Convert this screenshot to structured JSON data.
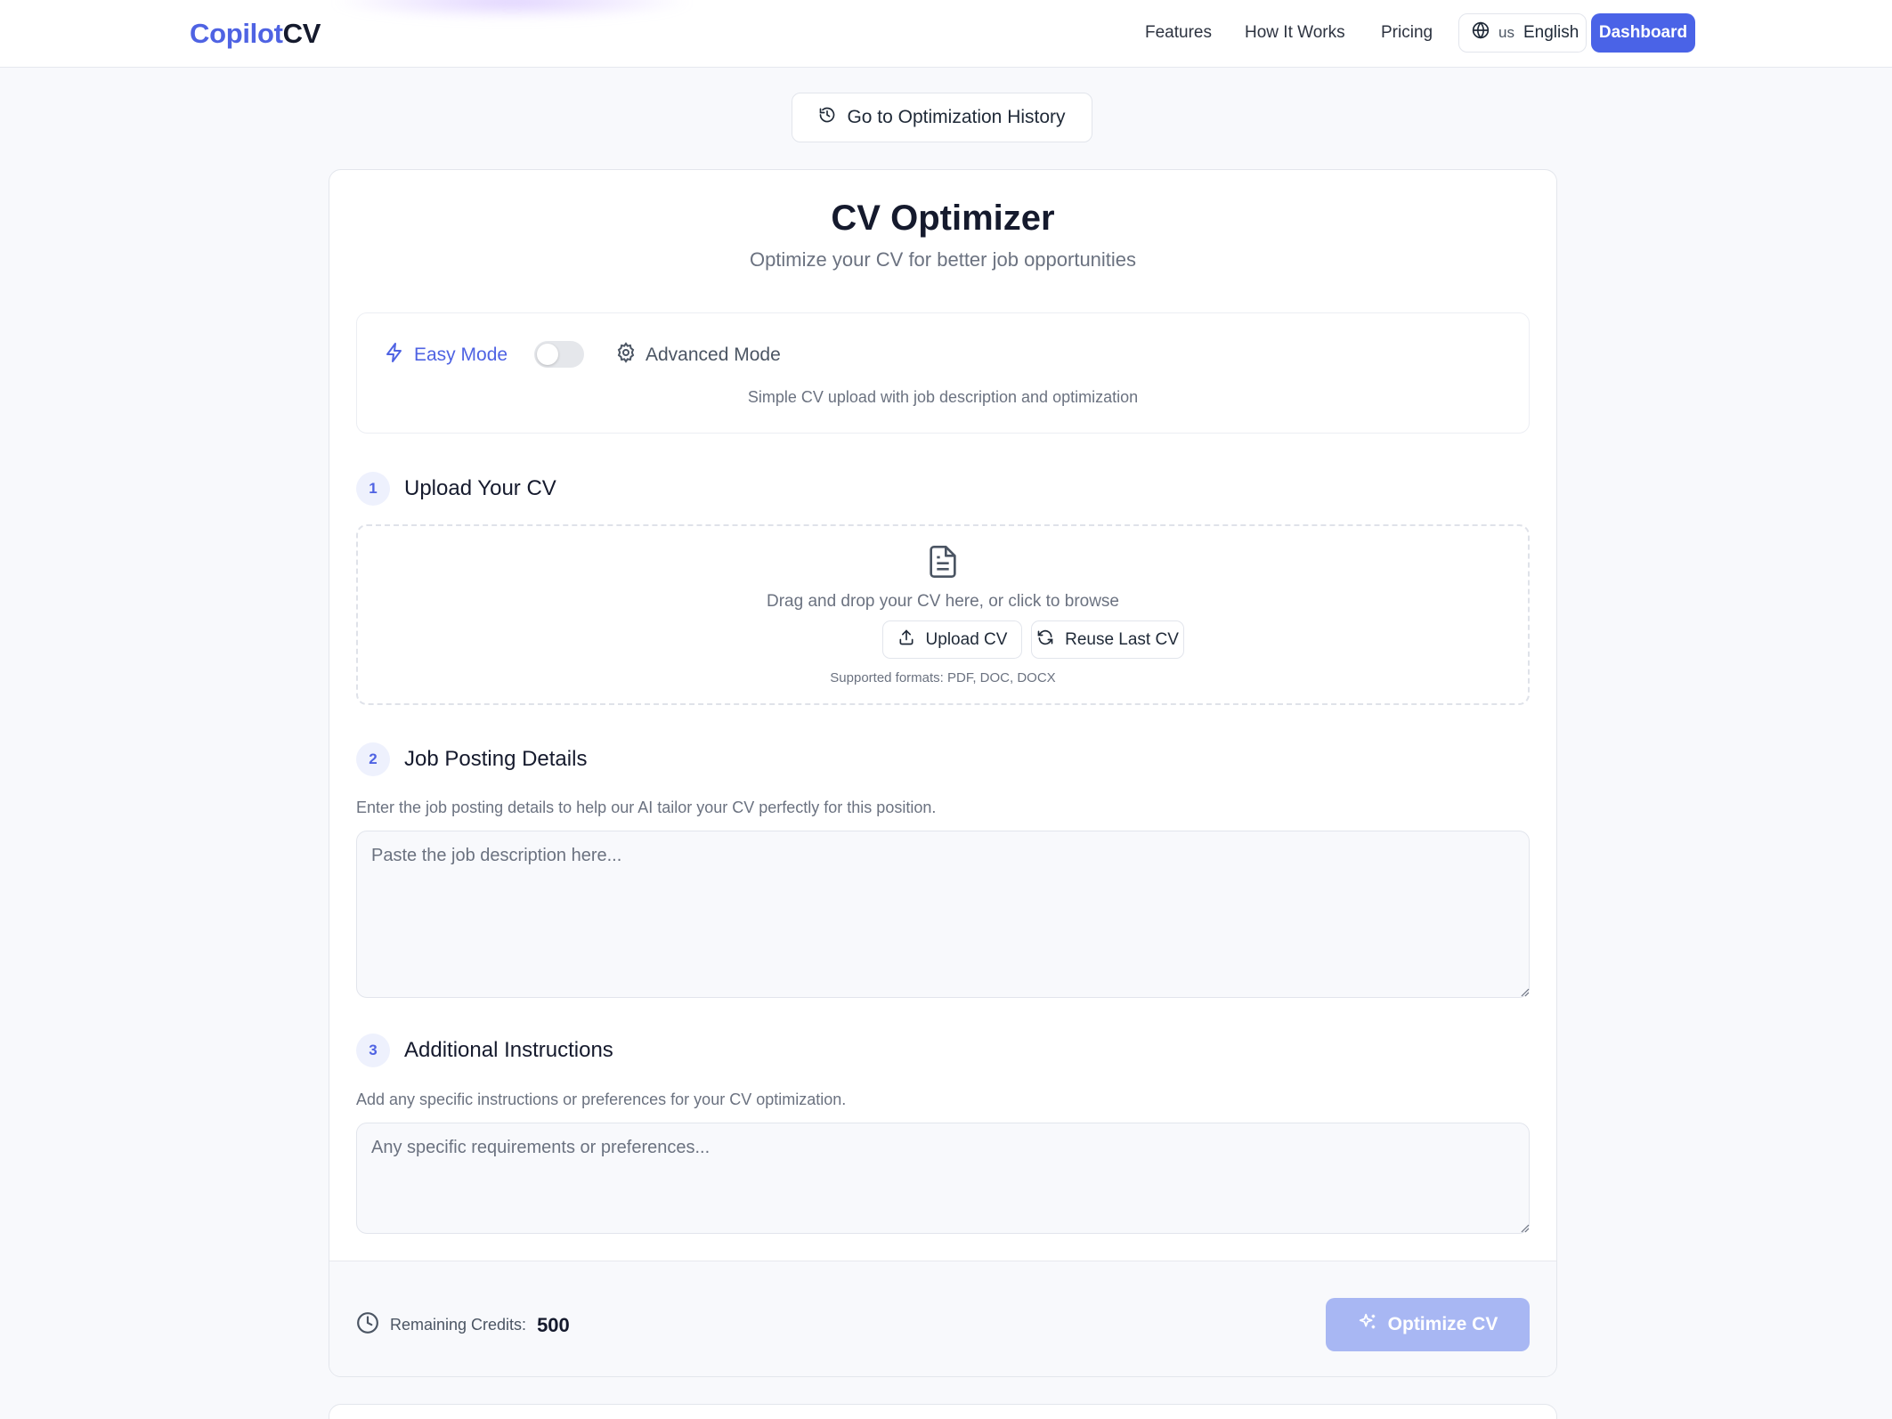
{
  "header": {
    "logo_part1": "Copilot",
    "logo_part2": "CV",
    "nav": [
      "Features",
      "How It Works",
      "Pricing"
    ],
    "language_code": "us",
    "language_name": "English",
    "dashboard_label": "Dashboard"
  },
  "history_button": "Go to Optimization History",
  "optimizer": {
    "title": "CV Optimizer",
    "subtitle": "Optimize your CV for better job opportunities",
    "mode": {
      "easy_label": "Easy Mode",
      "advanced_label": "Advanced Mode",
      "description": "Simple CV upload with job description and optimization",
      "advanced_enabled": false
    },
    "steps": [
      {
        "number": "1",
        "label": "Upload Your CV"
      },
      {
        "number": "2",
        "label": "Job Posting Details"
      },
      {
        "number": "3",
        "label": "Additional Instructions"
      }
    ],
    "upload": {
      "prompt": "Drag and drop your CV here, or click to browse",
      "upload_label": "Upload CV",
      "reuse_label": "Reuse Last CV",
      "formats": "Supported formats: PDF, DOC, DOCX"
    },
    "job": {
      "helper": "Enter the job posting details to help our AI tailor your CV perfectly for this position.",
      "placeholder": "Paste the job description here..."
    },
    "instructions": {
      "helper": "Add any specific instructions or preferences for your CV optimization.",
      "placeholder": "Any specific requirements or preferences..."
    },
    "footer": {
      "credits_label": "Remaining Credits:",
      "credits_value": "500",
      "optimize_label": "Optimize CV"
    }
  },
  "colors": {
    "accent": "#4a63e7",
    "accent_disabled": "#a8b7f3",
    "background": "#f8f9fc"
  }
}
